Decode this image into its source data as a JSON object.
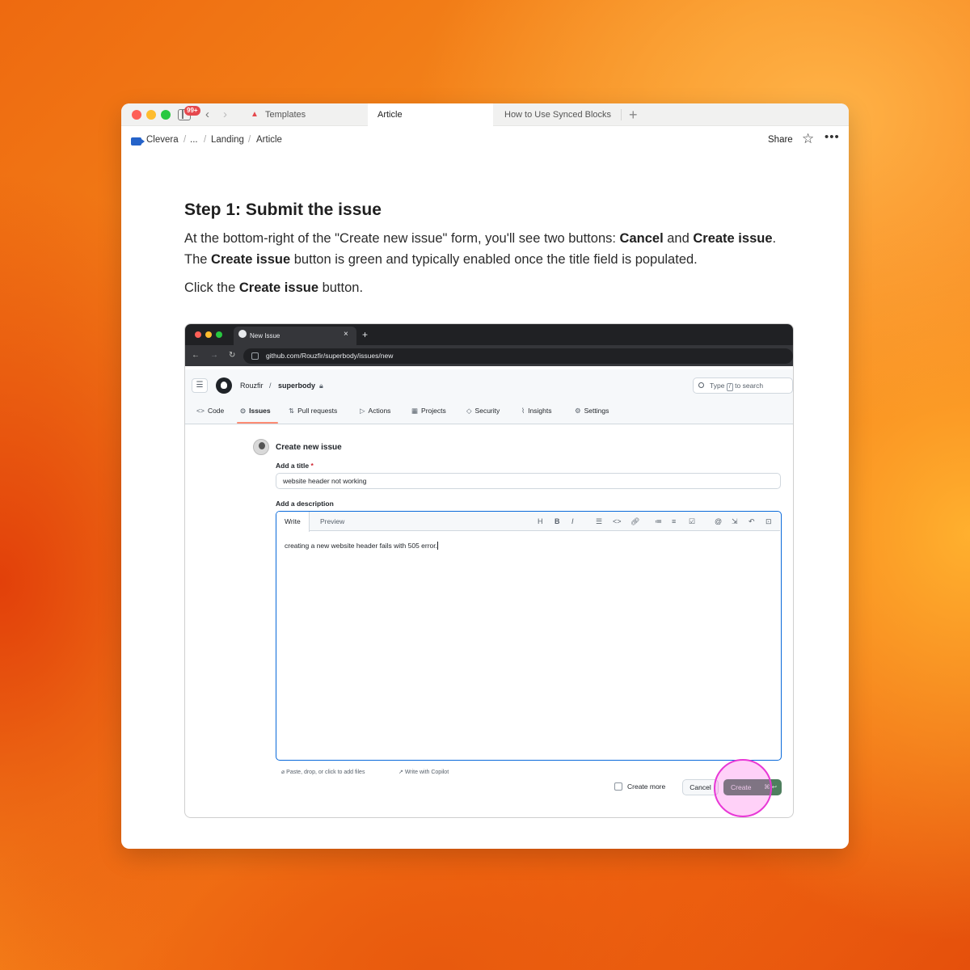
{
  "window": {
    "badge": "99+",
    "tabs": [
      {
        "label": "Templates",
        "icon": "notion-multicolor-icon"
      },
      {
        "label": "Article"
      },
      {
        "label": "How to Use Synced Blocks"
      }
    ]
  },
  "breadcrumb": {
    "items": [
      "Clevera",
      "...",
      "Landing",
      "Article"
    ],
    "share_label": "Share"
  },
  "article": {
    "heading": "Step 1: Submit the issue",
    "p1": {
      "t1": "At the bottom-right of the \"Create new issue\" form, you'll see two buttons: ",
      "b1": "Cancel",
      "t2": " and ",
      "b2": "Create issue",
      "t3": ". The ",
      "b3": "Create issue",
      "t4": " button is green and typically enabled once the title field is populated."
    },
    "p2": {
      "t1": "Click the ",
      "b1": "Create issue",
      "t2": " button."
    }
  },
  "screenshot": {
    "browser_tab": "New Issue",
    "url": "github.com/Rouzfir/superbody/issues/new",
    "owner": "Rouzfir",
    "repo": "superbody",
    "search": {
      "pre": "Type",
      "key": "/",
      "post": "to search"
    },
    "nav": [
      {
        "label": "Code",
        "icon": "<>"
      },
      {
        "label": "Issues",
        "icon": "⊙"
      },
      {
        "label": "Pull requests",
        "icon": "⇅"
      },
      {
        "label": "Actions",
        "icon": "▷"
      },
      {
        "label": "Projects",
        "icon": "▦"
      },
      {
        "label": "Security",
        "icon": "◇"
      },
      {
        "label": "Insights",
        "icon": "⌇"
      },
      {
        "label": "Settings",
        "icon": "⚙"
      }
    ],
    "form": {
      "heading": "Create new issue",
      "title_label": "Add a title",
      "required_mark": "*",
      "title_value": "website header not working",
      "description_label": "Add a description",
      "tab_write": "Write",
      "tab_preview": "Preview",
      "description_value": "creating a new website header fails with 505 error.",
      "attach_hint": "Paste, drop, or click to add files",
      "copilot_hint": "Write with Copilot",
      "create_more_label": "Create more",
      "cancel_label": "Cancel",
      "create_label": "Create",
      "create_shortcut": "⌘ ↩"
    }
  },
  "colors": {
    "create_button": "#4e7f5e",
    "highlight_ring": "#e838d6",
    "focus_border": "#0969da"
  }
}
